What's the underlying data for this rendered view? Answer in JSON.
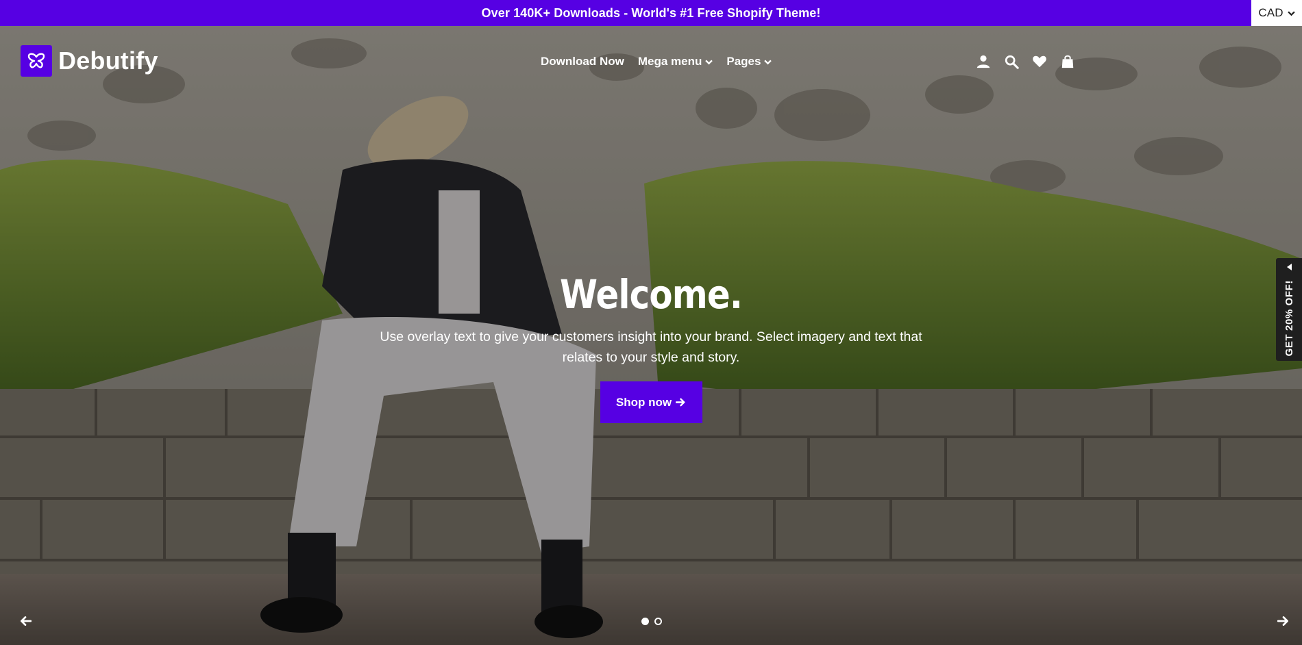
{
  "announcement": {
    "text": "Over 140K+ Downloads - World's #1 Free Shopify Theme!"
  },
  "currency": {
    "selected": "CAD"
  },
  "brand": {
    "name": "Debutify",
    "accent": "#5600e3"
  },
  "nav": {
    "items": [
      {
        "label": "Download Now",
        "has_dropdown": false
      },
      {
        "label": "Mega menu",
        "has_dropdown": true
      },
      {
        "label": "Pages",
        "has_dropdown": true
      }
    ]
  },
  "header_icons": [
    "user-icon",
    "search-icon",
    "heart-icon",
    "shopping-bag-icon"
  ],
  "hero": {
    "title": "Welcome.",
    "text": "Use overlay text to give your customers insight into your brand. Select imagery and text that relates to your style and story.",
    "button_label": "Shop now",
    "slides": 2,
    "active_slide": 1
  },
  "promo_tab": {
    "label": "GET 20% OFF!"
  }
}
